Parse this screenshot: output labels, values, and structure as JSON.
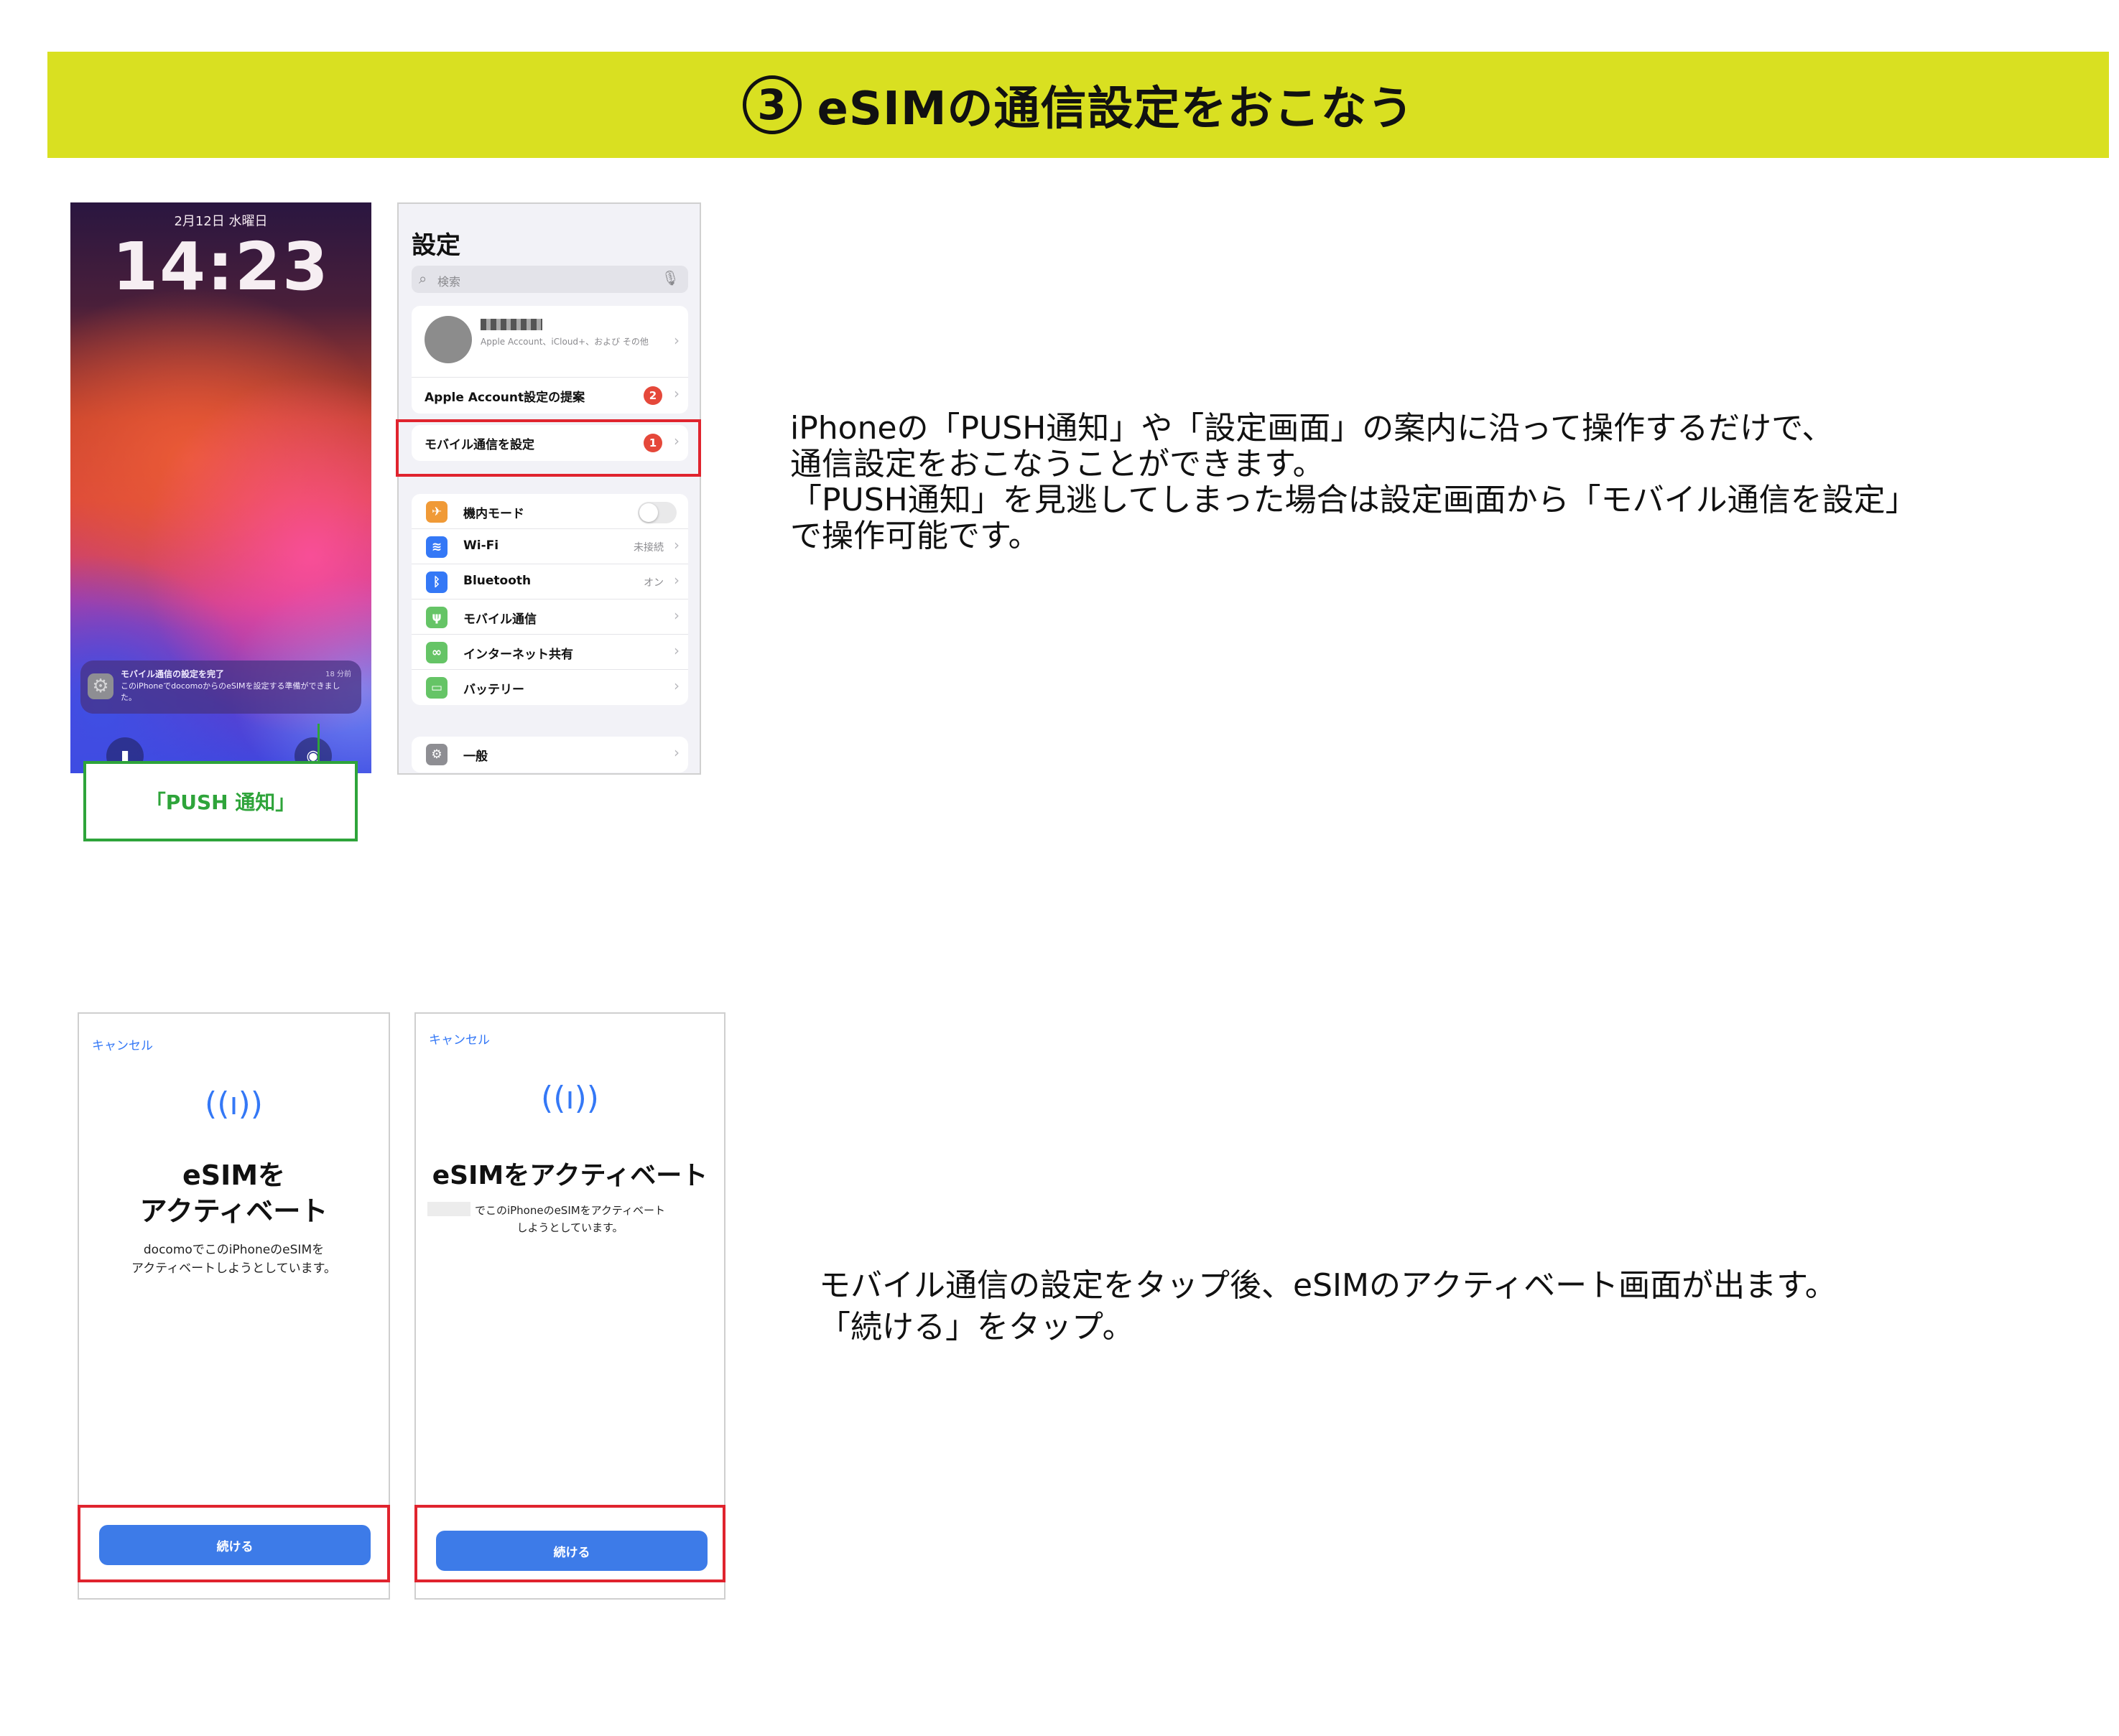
{
  "header": {
    "step_number": "3",
    "title": "eSIMの通信設定をおこなう"
  },
  "lockscreen": {
    "date": "2月12日 水曜日",
    "time": "14:23",
    "notification": {
      "title": "モバイル通信の設定を完了",
      "time": "18 分前",
      "body": "このiPhoneでdocomoからのeSIMを設定する準備ができました。"
    }
  },
  "callout": {
    "label": "「PUSH 通知」"
  },
  "settings": {
    "title": "設定",
    "search_placeholder": "検索",
    "account": {
      "subtitle": "Apple Account、iCloud+、および その他"
    },
    "suggestion": {
      "label": "Apple Account設定の提案",
      "badge": "2"
    },
    "mobile_setup": {
      "label": "モバイル通信を設定",
      "badge": "1"
    },
    "rows": [
      {
        "label": "機内モード",
        "value": "",
        "icon_color": "#f09a37",
        "icon": "airplane-icon"
      },
      {
        "label": "Wi-Fi",
        "value": "未接続",
        "icon_color": "#3478f6",
        "icon": "wifi-icon"
      },
      {
        "label": "Bluetooth",
        "value": "オン",
        "icon_color": "#3478f6",
        "icon": "bluetooth-icon"
      },
      {
        "label": "モバイル通信",
        "value": "",
        "icon_color": "#65c466",
        "icon": "antenna-icon"
      },
      {
        "label": "インターネット共有",
        "value": "",
        "icon_color": "#65c466",
        "icon": "link-icon"
      },
      {
        "label": "バッテリー",
        "value": "",
        "icon_color": "#65c466",
        "icon": "battery-icon"
      }
    ],
    "general": {
      "label": "一般"
    }
  },
  "descriptions": {
    "step1": "iPhoneの「PUSH通知」や「設定画面」の案内に沿って操作するだけで、\n通信設定をおこなうことができます。\n「PUSH通知」を見逃してしまった場合は設定画面から「モバイル通信を設定」\nで操作可能です。",
    "step2": "モバイル通信の設定をタップ後、eSIMのアクティベート画面が出ます。\n「続ける」をタップ。"
  },
  "esim_screen_1": {
    "cancel": "キャンセル",
    "title": "eSIMを\nアクティベート",
    "body": "docomoでこのiPhoneのeSIMを\nアクティベートしようとしています。",
    "button": "続ける"
  },
  "esim_screen_2": {
    "cancel": "キャンセル",
    "title": "eSIMをアクティベート",
    "body": "でこのiPhoneのeSIMをアクティベート\nしようとしています。",
    "button": "続ける"
  },
  "colors": {
    "banner": "#d9e021",
    "highlight_red": "#e0242e",
    "callout_green": "#2ea43a",
    "ios_blue": "#3478f6"
  }
}
